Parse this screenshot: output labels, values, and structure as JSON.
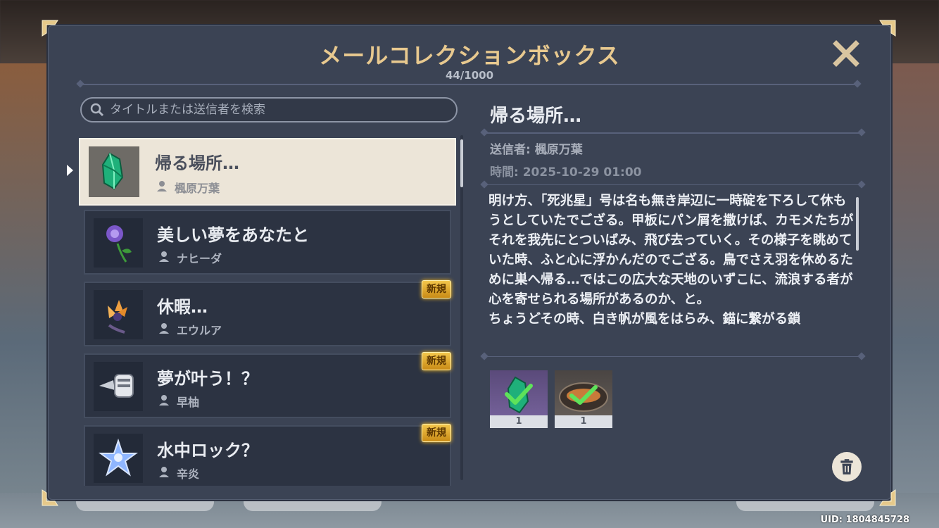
{
  "mailbox": {
    "title": "メールコレクションボックス",
    "count": "44/1000",
    "search_placeholder": "タイトルまたは送信者を検索"
  },
  "mails": [
    {
      "title": "帰る場所…",
      "sender": "楓原万葉",
      "selected": true,
      "new": false,
      "icon": "green-crystal-icon"
    },
    {
      "title": "美しい夢をあなたと",
      "sender": "ナヒーダ",
      "selected": false,
      "new": false,
      "icon": "purple-flower-icon"
    },
    {
      "title": "休暇…",
      "sender": "エウルア",
      "selected": false,
      "new": true,
      "icon": "orange-flower-icon"
    },
    {
      "title": "夢が叶う！？",
      "sender": "早柚",
      "selected": false,
      "new": true,
      "icon": "watering-can-icon"
    },
    {
      "title": "水中ロック？",
      "sender": "辛炎",
      "selected": false,
      "new": true,
      "icon": "star-crystal-icon"
    }
  ],
  "new_label": "新規",
  "detail": {
    "title": "帰る場所…",
    "sender": "送信者: 楓原万葉",
    "time": "時間: 2025-10-29 01:00",
    "body": "明け方、「死兆星」号は名も無き岸辺に一時碇を下ろして休もうとしていたでござる。甲板にパン屑を撒けば、カモメたちがそれを我先にとついばみ、飛び去っていく。その様子を眺めていた時、ふと心に浮かんだのでござる。鳥でさえ羽を休めるために巣へ帰る…ではこの広大な天地のいずこに、流浪する者が心を寄せられる場所があるのか、と。\nちょうどその時、白き帆が風をはらみ、錨に繋がる鎖",
    "attachments": [
      {
        "icon": "green-crystal-icon",
        "qty": "1",
        "claimed": true
      },
      {
        "icon": "fish-dish-icon",
        "qty": "1",
        "claimed": true
      }
    ]
  },
  "uid": "UID: 1804845728",
  "colors": {
    "panel": "#3b4354",
    "title_gold": "#e8c98f",
    "selected_bg": "#ece5d8",
    "new_badge": "#f3c64b"
  }
}
